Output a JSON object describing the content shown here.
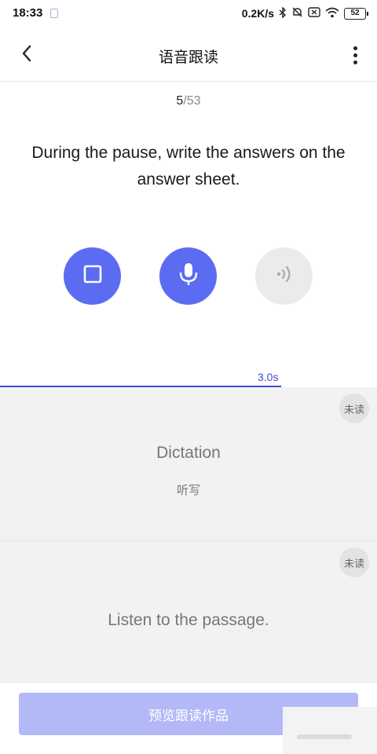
{
  "status_bar": {
    "time": "18:33",
    "network_speed": "0.2K/s",
    "battery": "52",
    "icons": [
      "document-icon",
      "bluetooth-icon",
      "mute-icon",
      "sim-off-icon",
      "wifi-icon",
      "battery-icon"
    ]
  },
  "header": {
    "title": "语音跟读",
    "back_icon": "chevron-left-icon",
    "more_icon": "more-vertical-icon"
  },
  "progress": {
    "current": "5",
    "total": "/53"
  },
  "sentence": "During the pause, write the answers on the answer sheet.",
  "controls": {
    "stop_icon": "stop-icon",
    "mic_icon": "microphone-icon",
    "play_icon": "audio-playback-icon",
    "accent_color": "#5b6cf2",
    "disabled_color": "#ebebeb"
  },
  "timer": {
    "label": "3.0s",
    "progress_fraction": 0.745
  },
  "cards": [
    {
      "badge": "未读",
      "text_en": "Dictation",
      "text_zh": "听写"
    },
    {
      "badge": "未读",
      "text_en": "Listen to the passage.",
      "text_zh": ""
    }
  ],
  "bottom": {
    "preview_label": "预览跟读作品",
    "button_color": "#b3b9f6"
  }
}
